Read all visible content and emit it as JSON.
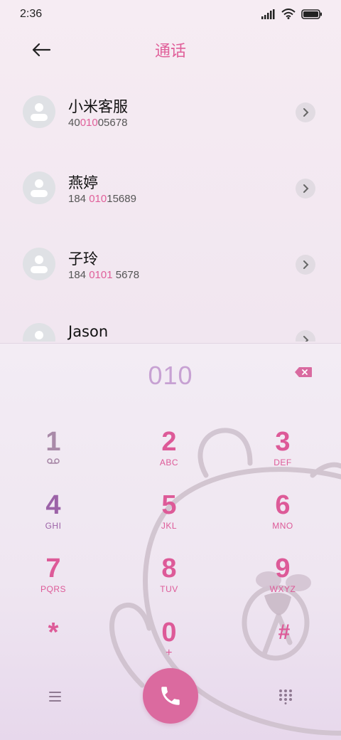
{
  "status_bar": {
    "time": "2:36",
    "icons": [
      "signal-icon",
      "wifi-icon",
      "battery-icon"
    ]
  },
  "header": {
    "back_icon": "arrow-left-icon",
    "title": "通话"
  },
  "contacts": [
    {
      "name": "小米客服",
      "number_pre": "40",
      "number_hl": "010",
      "number_post": "05678"
    },
    {
      "name": "燕婷",
      "number_pre": "184 ",
      "number_hl": "010",
      "number_post": "15689"
    },
    {
      "name": "子玲",
      "number_pre": "184 ",
      "number_hl": "0101",
      "number_post": " 5678"
    },
    {
      "name": "Jason",
      "number_pre": "",
      "number_hl": "",
      "number_post": ""
    }
  ],
  "dialer": {
    "input": "010",
    "keys": [
      {
        "digit": "1",
        "letters": ""
      },
      {
        "digit": "2",
        "letters": "ABC"
      },
      {
        "digit": "3",
        "letters": "DEF"
      },
      {
        "digit": "4",
        "letters": "GHI"
      },
      {
        "digit": "5",
        "letters": "JKL"
      },
      {
        "digit": "6",
        "letters": "MNO"
      },
      {
        "digit": "7",
        "letters": "PQRS"
      },
      {
        "digit": "8",
        "letters": "TUV"
      },
      {
        "digit": "9",
        "letters": "WXYZ"
      },
      {
        "digit": "*",
        "letters": ""
      },
      {
        "digit": "0",
        "letters": "+"
      },
      {
        "digit": "#",
        "letters": ""
      }
    ],
    "bottom": {
      "menu_icon": "menu-icon",
      "call_icon": "phone-icon",
      "dialpad_icon": "dialpad-icon"
    }
  },
  "colors": {
    "accent": "#e0609a",
    "call_button": "#db6a9f",
    "display_text": "#c7a1d3"
  }
}
